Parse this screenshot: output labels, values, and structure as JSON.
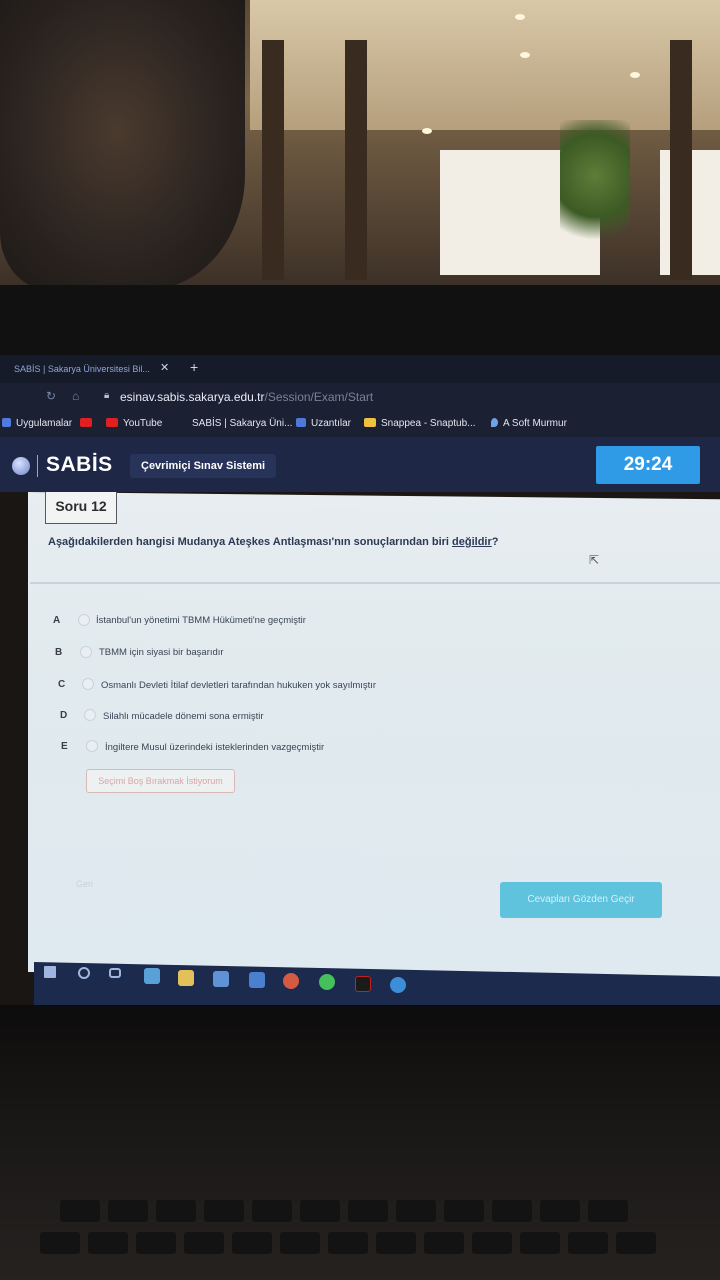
{
  "browser": {
    "tab_title": "SABİS | Sakarya Üniversitesi Bil...",
    "url_host": "esinav.sabis.sakarya.edu.tr",
    "url_path": "/Session/Exam/Start",
    "bookmarks": [
      "Uygulamalar",
      "YouTube",
      "SABİS | Sakarya Üni...",
      "Uzantılar",
      "Snappea - Snaptub...",
      "A Soft Murmur"
    ]
  },
  "app": {
    "logo": "SABİS",
    "subtitle": "Çevrimiçi Sınav Sistemi",
    "timer": "29:24"
  },
  "question": {
    "number_label": "Soru 12",
    "text_before": "Aşağıdakilerden hangisi Mudanya Ateşkes Antlaşması'nın sonuçlarından biri ",
    "text_negation": "değildir",
    "text_after": "?",
    "options": [
      {
        "letter": "A",
        "text": "İstanbul'un yönetimi TBMM Hükümeti'ne geçmiştir"
      },
      {
        "letter": "B",
        "text": "TBMM için siyasi bir başarıdır"
      },
      {
        "letter": "C",
        "text": "Osmanlı Devleti İtilaf devletleri tarafından hukuken yok sayılmıştır"
      },
      {
        "letter": "D",
        "text": "Silahlı mücadele dönemi sona ermiştir"
      },
      {
        "letter": "E",
        "text": "İngiltere Musul üzerindeki isteklerinden vazgeçmiştir"
      }
    ],
    "skip_label": "Seçimi Boş Bırakmak İstiyorum",
    "back_label": "Geri",
    "review_label": "Cevapları Gözden Geçir"
  },
  "colors": {
    "header_bg": "#1e2746",
    "timer_bg": "#2f9be6",
    "review_button": "#5fc3de"
  },
  "taskbar": {
    "icons": [
      "windows-start-icon",
      "search-icon",
      "task-view-icon",
      "store-icon",
      "file-explorer-icon",
      "mail-icon",
      "app-icon",
      "chrome-icon",
      "whatsapp-icon",
      "netflix-icon",
      "edge-icon"
    ]
  }
}
